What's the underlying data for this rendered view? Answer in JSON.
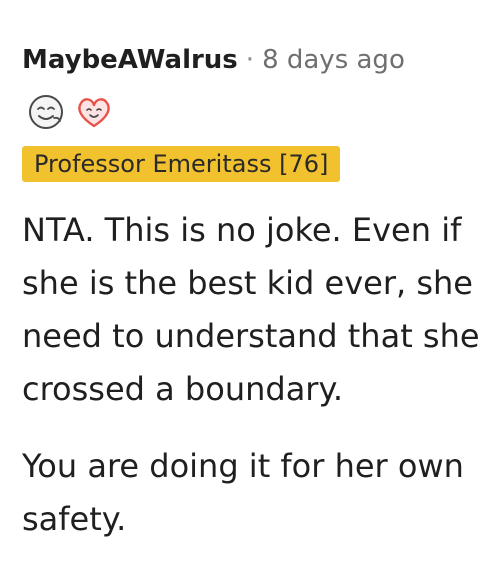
{
  "comment": {
    "username": "MaybeAWalrus",
    "separator": "·",
    "timestamp": "8 days ago",
    "badges": [
      {
        "icon": "smiling-face-badge-icon"
      },
      {
        "icon": "heart-face-badge-icon"
      }
    ],
    "rank_label": "Professor Emeritass [76]",
    "paragraphs": [
      "NTA. This is no joke. Even if she is the best kid ever, she need to understand that she crossed a boundary.",
      "You are doing it for her own safety."
    ],
    "colors": {
      "rank_background": "#f2c12e",
      "heart_badge": "#e8524a"
    }
  }
}
